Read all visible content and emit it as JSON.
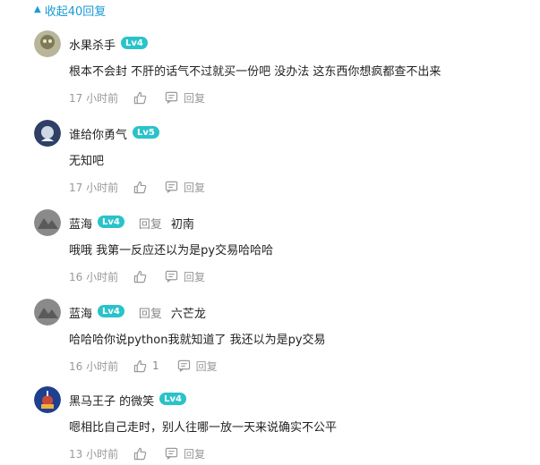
{
  "collapse": {
    "icon": "triangle-up-icon",
    "label": "收起40回复"
  },
  "colors": {
    "accent": "#1a9bd6",
    "level_badge": "#29c3c9",
    "meta_text": "#999999"
  },
  "comments": [
    {
      "user": "水果杀手",
      "level": "Lv4",
      "text": "根本不会封 不肝的话气不过就买一份吧 没办法 这东西你想疯都查不出来",
      "time": "17 小时前",
      "reply_label": "回复"
    },
    {
      "user": "谁给你勇气",
      "level": "Lv5",
      "text": "无知吧",
      "time": "17 小时前",
      "reply_label": "回复"
    },
    {
      "user": "蓝海",
      "level": "Lv4",
      "reply_to_label": "回复",
      "reply_to_user": "初南",
      "text": "哦哦 我第一反应还以为是py交易哈哈哈",
      "time": "16 小时前",
      "reply_label": "回复"
    },
    {
      "user": "蓝海",
      "level": "Lv4",
      "reply_to_label": "回复",
      "reply_to_user": "六芒龙",
      "text": "哈哈哈你说python我就知道了 我还以为是py交易",
      "time": "16 小时前",
      "like_count": "1",
      "reply_label": "回复"
    },
    {
      "user": "黑马王子 的微笑",
      "level": "Lv4",
      "text": "嗯相比自己走时，别人往哪一放一天来说确实不公平",
      "time": "13 小时前",
      "reply_label": "回复"
    }
  ]
}
